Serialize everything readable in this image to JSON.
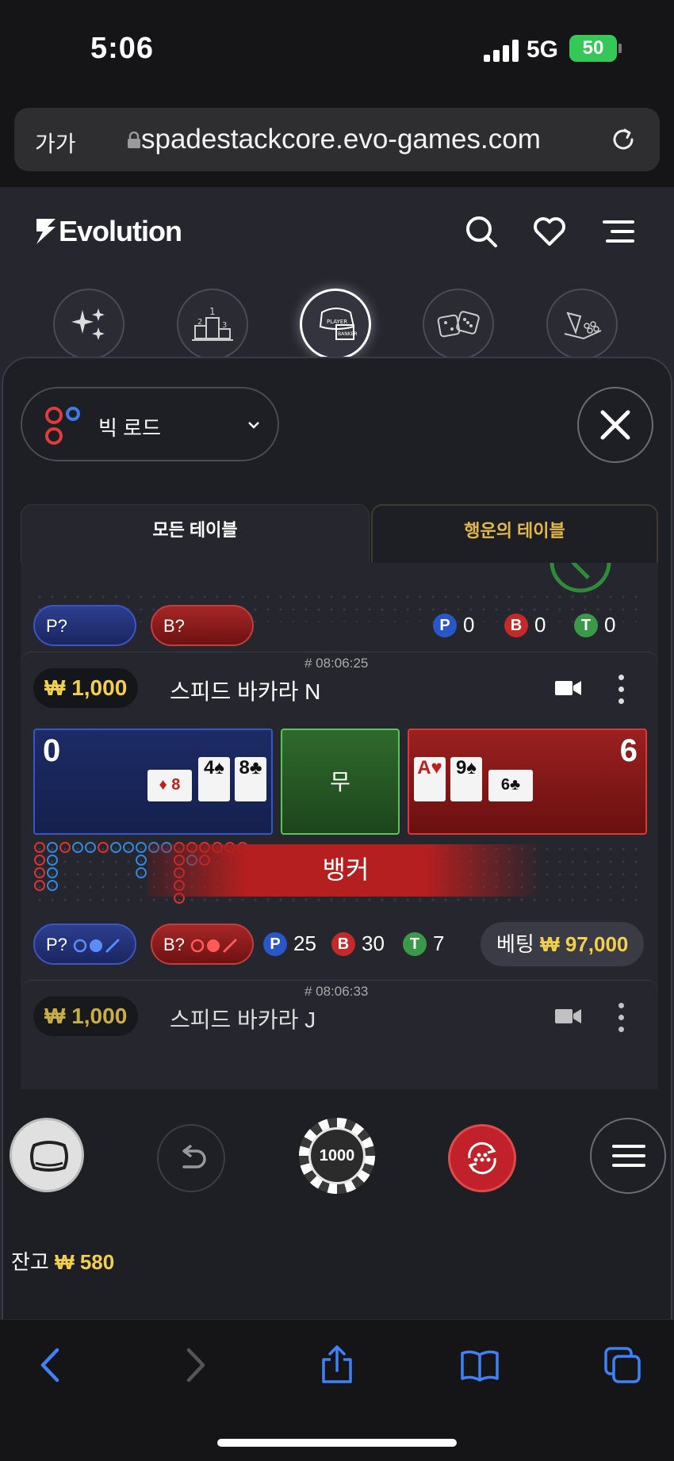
{
  "status_bar": {
    "time": "5:06",
    "network": "5G",
    "battery": "50"
  },
  "browser": {
    "text_size_label": "가가",
    "url": "spadestackcore.evo-games.com"
  },
  "site": {
    "brand": "Evolution",
    "header_icons": [
      "search-icon",
      "heart-icon",
      "menu-icon"
    ],
    "categories": [
      "sparkle-icon",
      "podium-icon",
      "baccarat-icon",
      "dice-icon",
      "roulette-icon"
    ],
    "active_category": "baccarat-icon"
  },
  "panel": {
    "road_select": "빅 로드",
    "tabs": {
      "all": "모든 테이블",
      "lucky": "행운의 테이블"
    }
  },
  "cards": {
    "partial": {
      "p_label": "P?",
      "b_label": "B?",
      "player_count": "0",
      "banker_count": "0",
      "tie_count": "0"
    },
    "main": {
      "game_id": "# 08:06:25",
      "limit": "₩ 1,000",
      "name": "스피드 바카라 N",
      "player_score": "0",
      "banker_score": "6",
      "tie_label": "무",
      "player_cards": [
        "4♠",
        "8♣"
      ],
      "player_side_card": "♦ 8",
      "banker_cards": [
        "A♥",
        "9♠"
      ],
      "banker_side_card": "6♣",
      "result": "뱅커",
      "p_label": "P?",
      "b_label": "B?",
      "player_count": "25",
      "banker_count": "30",
      "tie_count": "7",
      "bet_label": "베팅",
      "bet_amount": "₩ 97,000"
    },
    "next": {
      "game_id": "# 08:06:33",
      "limit": "₩ 1,000",
      "name": "스피드 바카라 J"
    }
  },
  "badges": {
    "player": "P",
    "banker": "B",
    "tie": "T"
  },
  "controls": {
    "chip_value": "1000",
    "balance_label": "잔고",
    "balance_amount": "₩ 580"
  },
  "colors": {
    "gold": "#f3cf50",
    "player_blue": "#2957c8",
    "banker_red": "#c42a2a",
    "tie_green": "#3a9a4a",
    "lucky_gold": "#e2b84a"
  }
}
